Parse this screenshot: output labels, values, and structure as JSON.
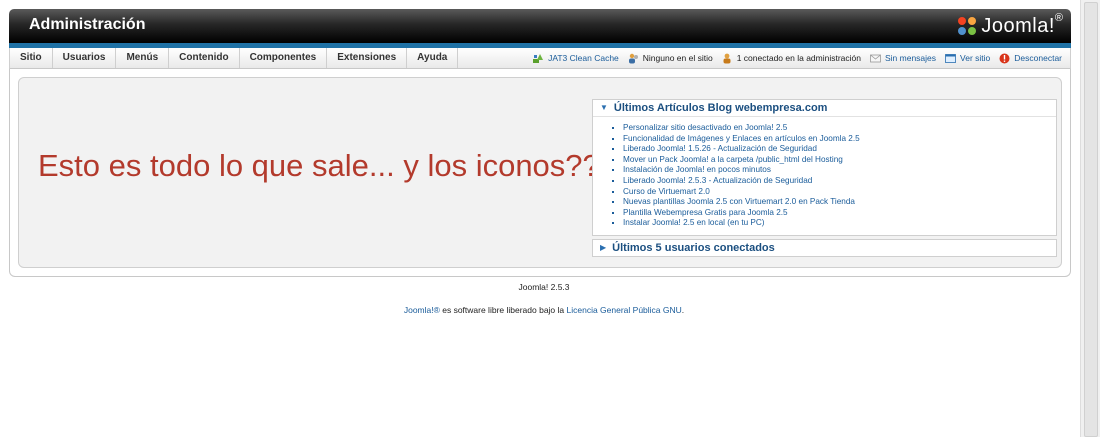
{
  "header": {
    "title": "Administración",
    "logo_text": "Joomla!",
    "logo_sup": "®"
  },
  "menu": {
    "items": [
      {
        "label": "Sitio"
      },
      {
        "label": "Usuarios"
      },
      {
        "label": "Menús"
      },
      {
        "label": "Contenido"
      },
      {
        "label": "Componentes"
      },
      {
        "label": "Extensiones"
      },
      {
        "label": "Ayuda"
      }
    ]
  },
  "status": {
    "cache": "JAT3 Clean Cache",
    "site_users": "Ninguno en el sitio",
    "admin_users": "1 conectado en la administración",
    "messages": "Sin mensajes",
    "view_site": "Ver sitio",
    "logout": "Desconectar"
  },
  "overlay_message": "Esto es todo lo que sale... y los iconos???",
  "modules": {
    "blog": {
      "title": "Últimos Artículos Blog webempresa.com",
      "items": [
        "Personalizar sitio desactivado en Joomla! 2.5",
        "Funcionalidad de Imágenes y Enlaces en artículos en Joomla 2.5",
        "Liberado Joomla! 1.5.26 - Actualización de Seguridad",
        "Mover un Pack Joomla! a la carpeta /public_html del Hosting",
        "Instalación de Joomla! en pocos minutos",
        "Liberado Joomla! 2.5.3 - Actualización de Seguridad",
        "Curso de Virtuemart 2.0",
        "Nuevas plantillas Joomla 2.5 con Virtuemart 2.0 en Pack Tienda",
        "Plantilla Webempresa Gratis para Joomla 2.5",
        "Instalar Joomla! 2.5 en local (en tu PC)"
      ]
    },
    "users": {
      "title": "Últimos 5 usuarios conectados"
    }
  },
  "footer": {
    "version": "Joomla! 2.5.3",
    "license_prefix": "Joomla!®",
    "license_mid": " es software libre liberado bajo la ",
    "license_link": "Licencia General Pública GNU",
    "license_suffix": "."
  },
  "colors": {
    "accent_blue": "#1f72a6",
    "link": "#1a5c9a",
    "overlay_red": "#b33a2c"
  }
}
